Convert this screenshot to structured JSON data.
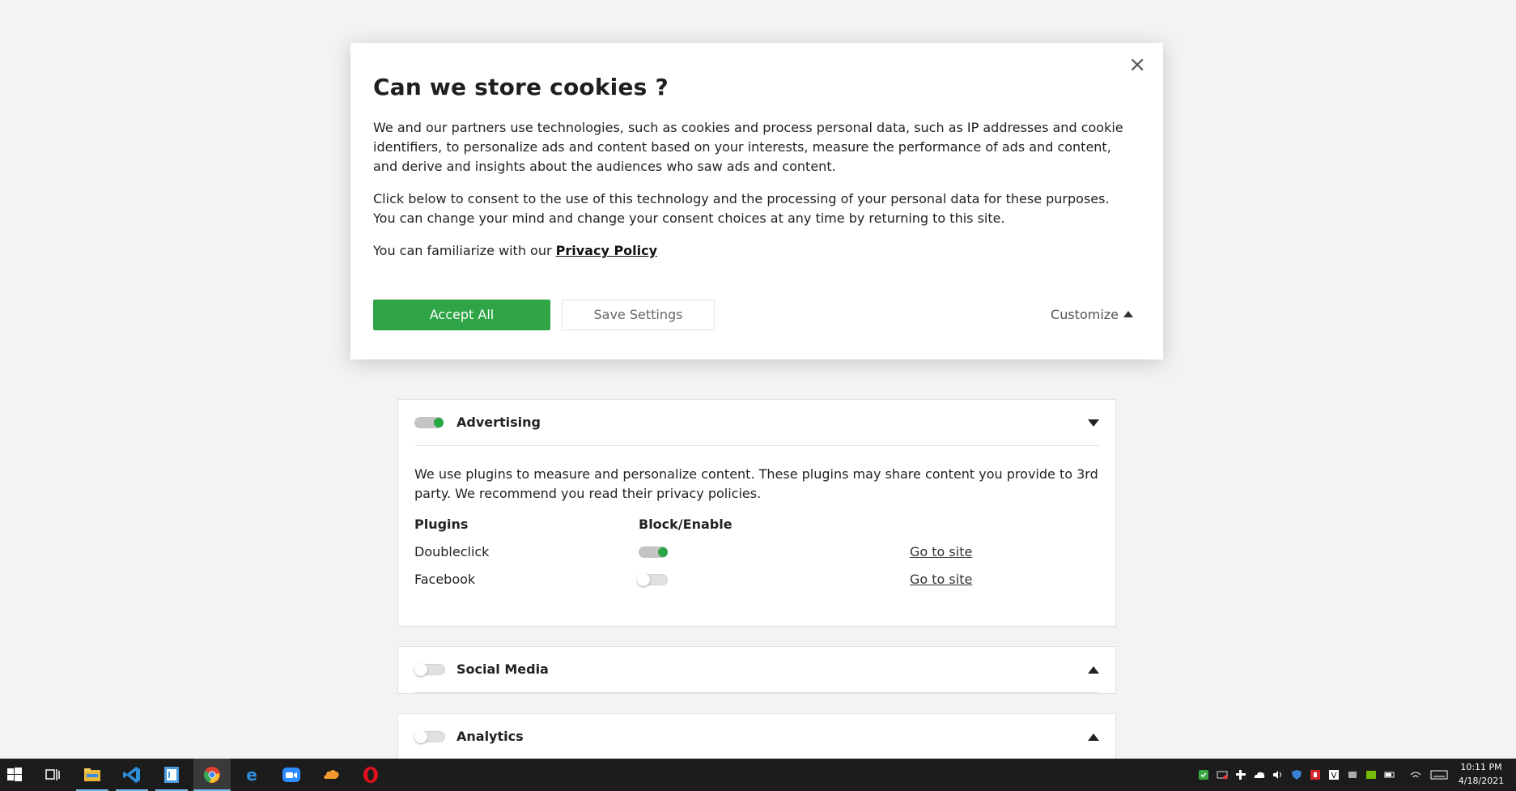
{
  "modal": {
    "title": "Can we store cookies ?",
    "close_glyph": "×",
    "para1": "We and our partners use technologies, such as cookies and process personal data, such as IP addresses and cookie identifiers, to personalize ads and content based on your interests, measure the performance of ads and content, and derive and insights about the audiences who saw ads and content.",
    "para2": "Click below to consent to the use of this technology and the processing of your personal data for these purposes. You can change your mind and change your consent choices at any time by returning to this site.",
    "para3_prefix": "You can familiarize with our",
    "privacy_link": "Privacy Policy",
    "accept_label": "Accept All",
    "save_label": "Save Settings",
    "customize_label": "Customize"
  },
  "sections": {
    "advertising": {
      "title": "Advertising",
      "enabled": true,
      "description": "We use plugins to measure and personalize content. These plugins may share content you provide to 3rd party. We recommend you read their privacy policies.",
      "col_plugins": "Plugins",
      "col_block": "Block/Enable",
      "plugins": [
        {
          "name": "Doubleclick",
          "enabled": true,
          "link": "Go to site"
        },
        {
          "name": "Facebook",
          "enabled": false,
          "link": "Go to site"
        }
      ]
    },
    "social": {
      "title": "Social Media",
      "enabled": false
    },
    "analytics": {
      "title": "Analytics",
      "enabled": false
    }
  },
  "taskbar": {
    "time": "10:11 PM",
    "date": "4/18/2021",
    "apps": [
      "start-icon",
      "task-view-icon",
      "file-explorer-icon",
      "vscode-icon",
      "notepad-icon",
      "chrome-icon",
      "edge-icon",
      "zoom-icon",
      "cloud-app-icon",
      "opera-icon"
    ]
  },
  "colors": {
    "accent_green": "#2ea447",
    "background": "#f3f3f3",
    "taskbar": "#1c1c1c"
  }
}
